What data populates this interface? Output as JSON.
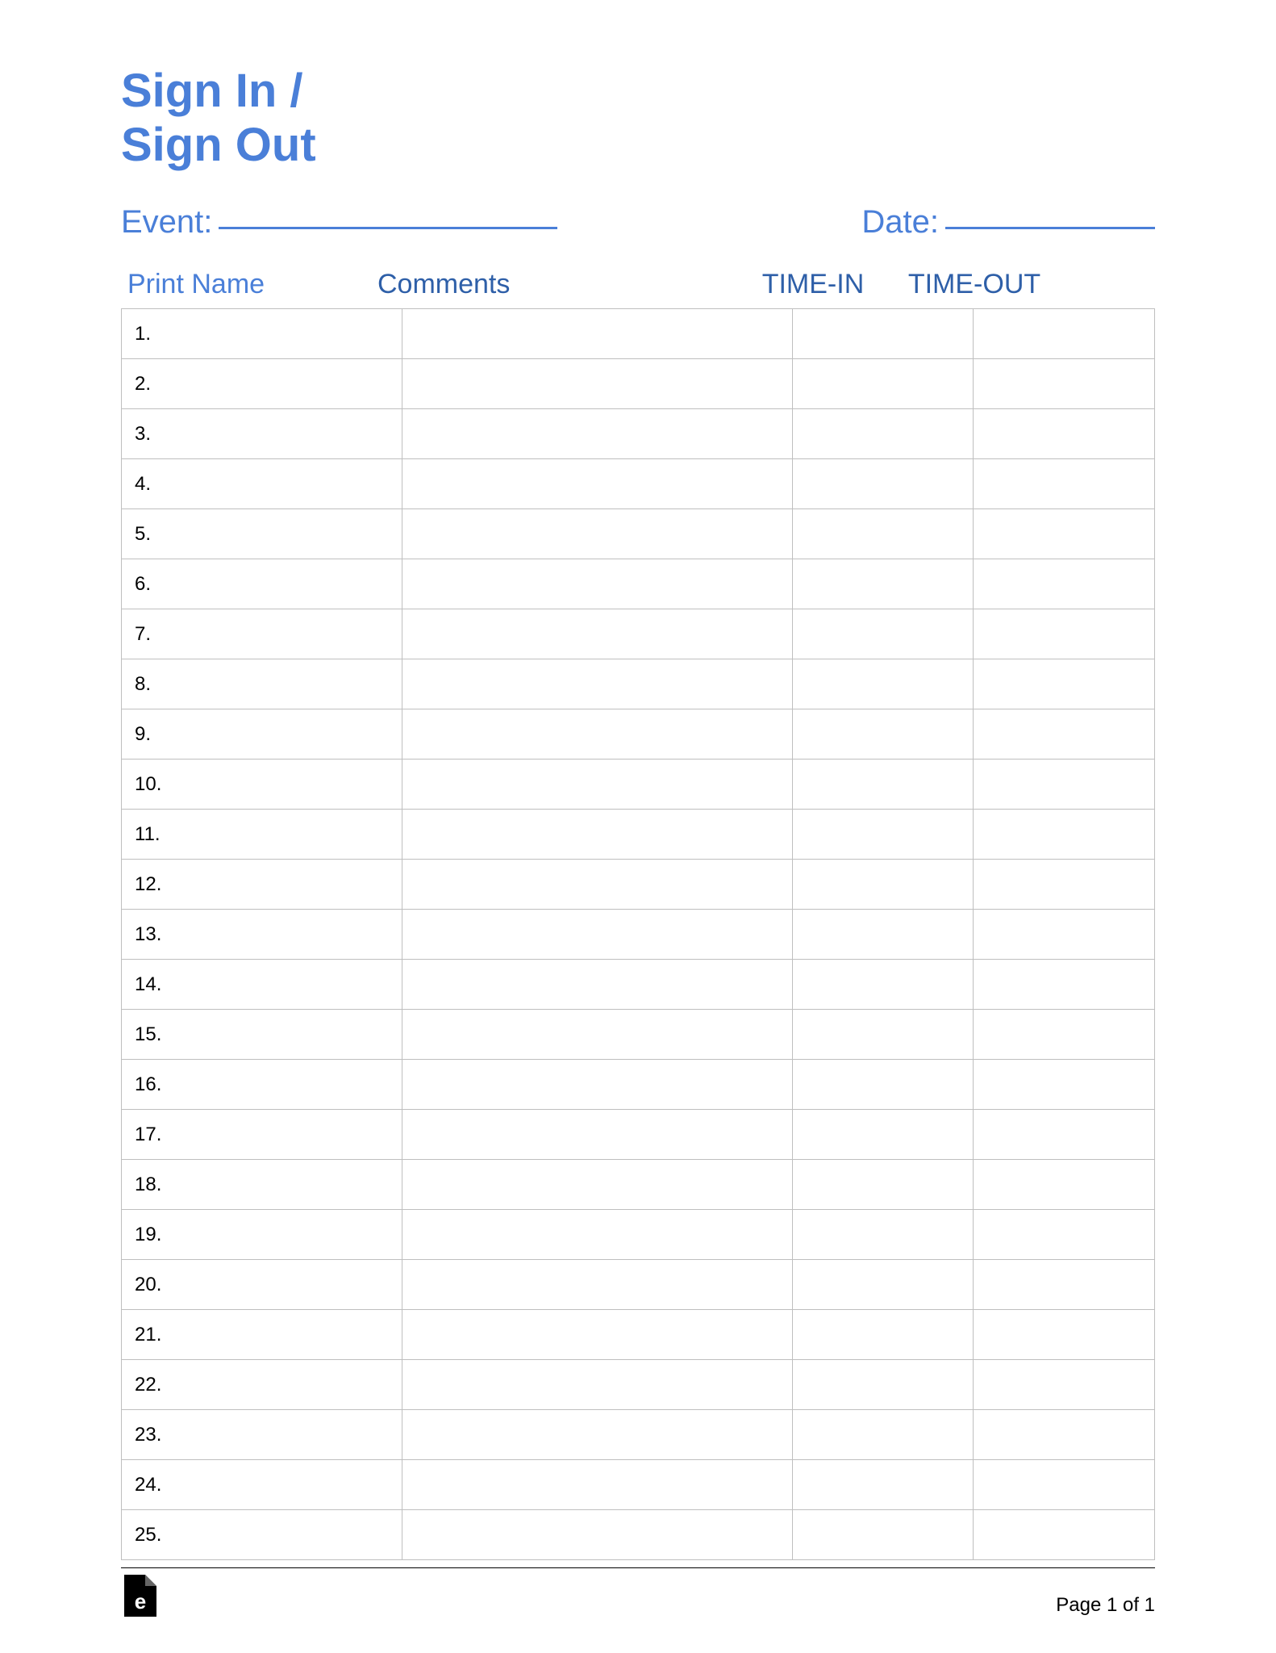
{
  "title_line1": "Sign In /",
  "title_line2": "Sign Out",
  "event_label": "Event:",
  "date_label": "Date:",
  "headers": {
    "print_name": "Print Name",
    "comments": "Comments",
    "time_in": "TIME-IN",
    "time_out": "TIME-OUT"
  },
  "rows": [
    {
      "num": "1."
    },
    {
      "num": "2."
    },
    {
      "num": "3."
    },
    {
      "num": "4."
    },
    {
      "num": "5."
    },
    {
      "num": "6."
    },
    {
      "num": "7."
    },
    {
      "num": "8."
    },
    {
      "num": "9."
    },
    {
      "num": "10."
    },
    {
      "num": "11."
    },
    {
      "num": "12."
    },
    {
      "num": "13."
    },
    {
      "num": "14."
    },
    {
      "num": "15."
    },
    {
      "num": "16."
    },
    {
      "num": "17."
    },
    {
      "num": "18."
    },
    {
      "num": "19."
    },
    {
      "num": "20."
    },
    {
      "num": "21."
    },
    {
      "num": "22."
    },
    {
      "num": "23."
    },
    {
      "num": "24."
    },
    {
      "num": "25."
    }
  ],
  "footer": {
    "page_text": "Page 1 of 1"
  }
}
